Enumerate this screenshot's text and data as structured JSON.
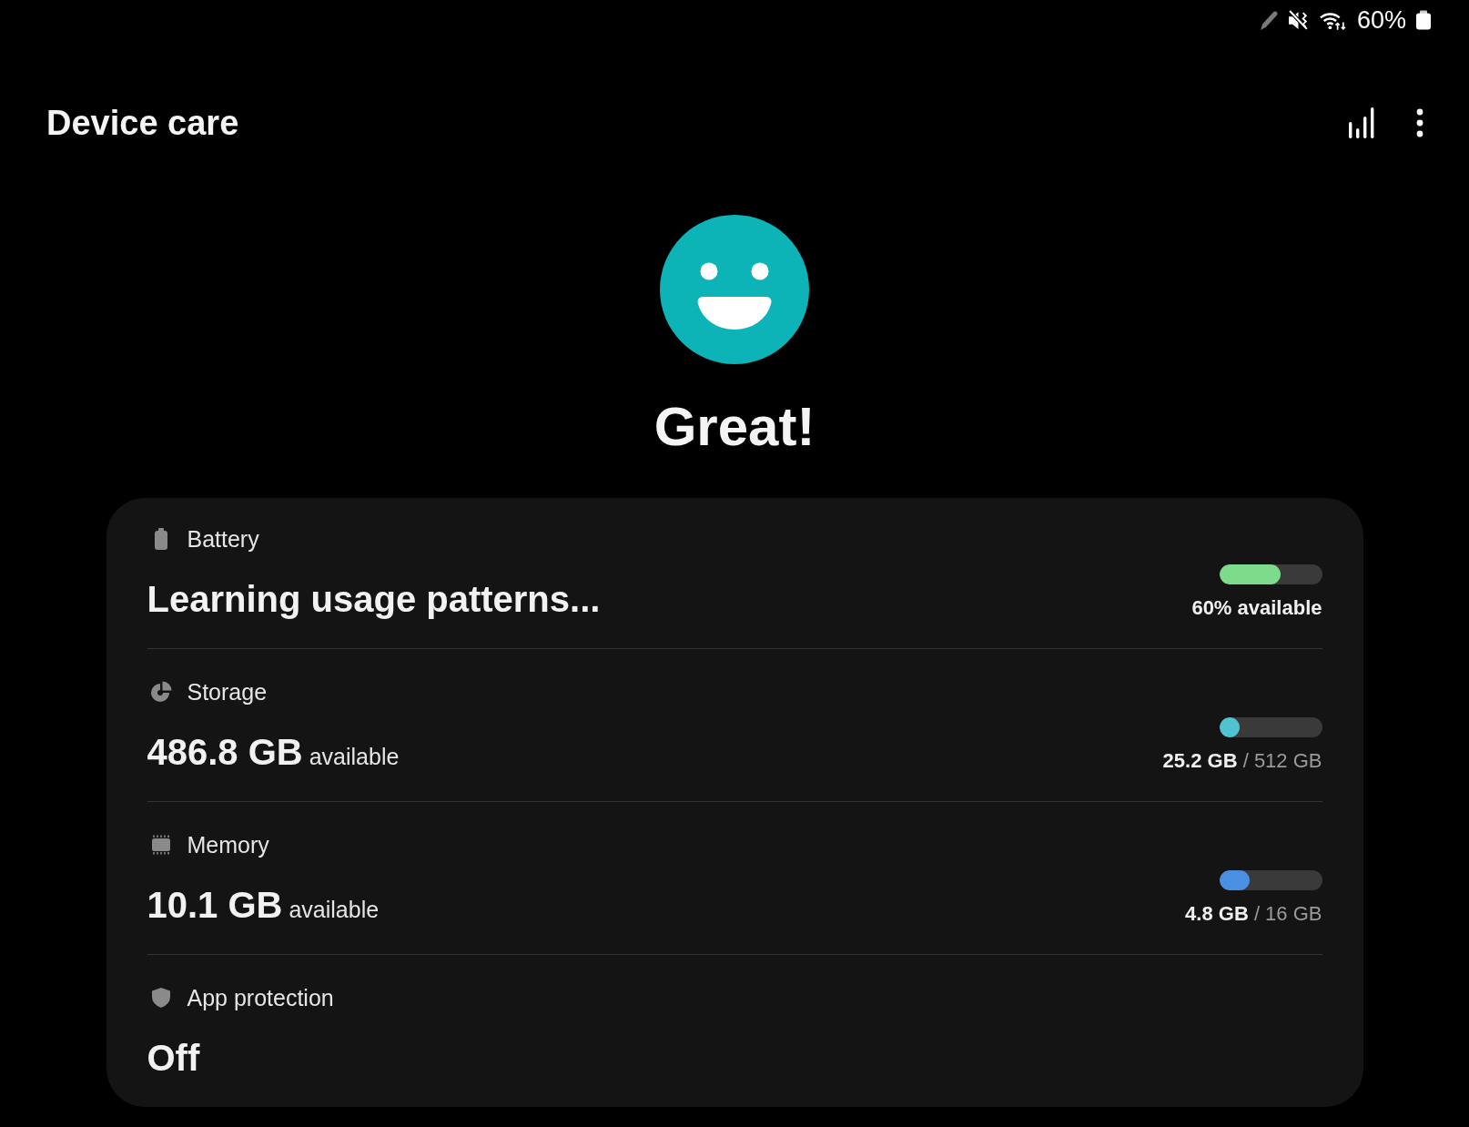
{
  "status_bar": {
    "battery_percent": "60%"
  },
  "header": {
    "title": "Device care"
  },
  "status": {
    "text": "Great!"
  },
  "rows": [
    {
      "kind": "status",
      "label": "Battery",
      "value": "Learning usage patterns...",
      "level": 0.6,
      "color": "#7ddc8b",
      "reading": "60% available"
    },
    {
      "kind": "capacity",
      "label": "Storage",
      "value": "**486.8 GB** available",
      "level": 0.2,
      "color": "#4fc3cf",
      "reading": "**25.2 GB** / 512 GB"
    },
    {
      "kind": "capacity",
      "label": "Memory",
      "value": "**10.1 GB** available",
      "level": 0.3,
      "color": "#4a90e2",
      "reading": "**4.8 GB** / 16 GB"
    },
    {
      "kind": "text",
      "label": "App protection",
      "value": "Off"
    }
  ]
}
